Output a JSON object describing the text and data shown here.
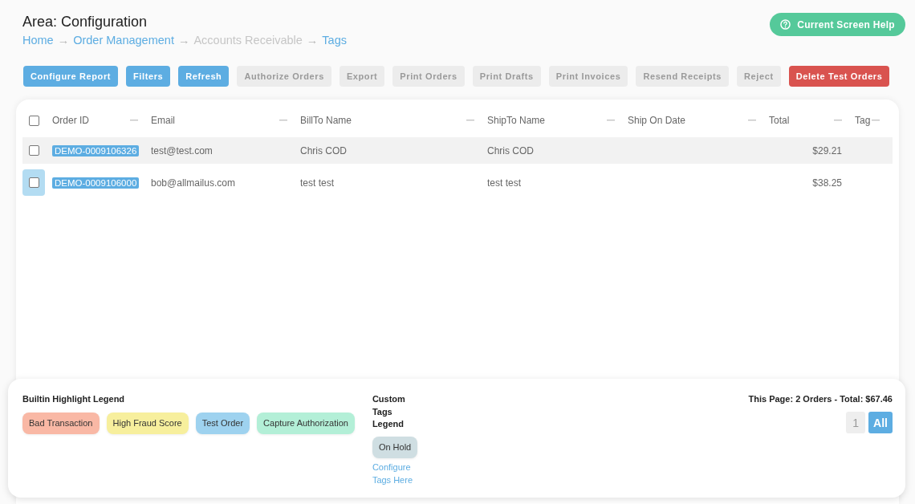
{
  "header": {
    "title": "Area: Configuration",
    "help_button": "Current Screen Help"
  },
  "breadcrumb": [
    {
      "label": "Home",
      "disabled": false,
      "separator": "→"
    },
    {
      "label": "Order Management",
      "disabled": false,
      "separator": "→"
    },
    {
      "label": "Accounts Receivable",
      "disabled": true,
      "separator": "→"
    },
    {
      "label": "Tags",
      "disabled": false
    }
  ],
  "toolbar": [
    {
      "label": "Configure Report",
      "kind": "primary",
      "disabled": false
    },
    {
      "label": "Filters",
      "kind": "primary",
      "disabled": false
    },
    {
      "label": "Refresh",
      "kind": "primary",
      "disabled": false
    },
    {
      "label": "Authorize Orders",
      "kind": "primary",
      "disabled": true
    },
    {
      "label": "Export",
      "kind": "primary",
      "disabled": true
    },
    {
      "label": "Print Orders",
      "kind": "primary",
      "disabled": true
    },
    {
      "label": "Print Drafts",
      "kind": "primary",
      "disabled": true
    },
    {
      "label": "Print Invoices",
      "kind": "primary",
      "disabled": true
    },
    {
      "label": "Resend Receipts",
      "kind": "primary",
      "disabled": true
    },
    {
      "label": "Reject",
      "kind": "primary",
      "disabled": true
    },
    {
      "label": "Delete Test Orders",
      "kind": "danger",
      "disabled": false
    }
  ],
  "table": {
    "select_all": {
      "checked": false
    },
    "columns": [
      "Order ID",
      "Email",
      "BillTo Name",
      "ShipTo Name",
      "Ship On Date",
      "Total",
      "Tag"
    ],
    "rows": [
      {
        "kind": "test_order",
        "checked": false,
        "hovered": true,
        "focused": false,
        "order_id": "DEMO-0009106326",
        "email": "test@test.com",
        "billto_name": "Chris COD",
        "shipto_name": "Chris COD",
        "total": "$29.21"
      },
      {
        "kind": "test_order",
        "checked": false,
        "hovered": false,
        "focused": true,
        "order_id": "DEMO-0009106000",
        "email": "bob@allmailus.com",
        "billto_name": "test test",
        "shipto_name": "test test",
        "total": "$38.25"
      }
    ]
  },
  "legend": {
    "builtin": {
      "title": "Builtin Highlight Legend",
      "items": [
        {
          "label": "Bad Transaction",
          "color": "#f9b8a5"
        },
        {
          "label": "High Fraud Score",
          "color": "#f7ef9d"
        },
        {
          "label": "Test Order",
          "color": "#9ed2ef"
        },
        {
          "label": "Capture Authorization",
          "color": "#b3efd7"
        }
      ]
    },
    "custom": {
      "title": "Custom Tags Legend",
      "items": [
        {
          "label": "On Hold",
          "color": "#cfdee2"
        }
      ],
      "link": "Configure Tags Here"
    }
  },
  "summary": {
    "text": "This Page: 2 Orders - Total: $67.46",
    "pages": [
      {
        "label": "1",
        "selected": false
      },
      {
        "label": "All",
        "selected": true
      }
    ]
  }
}
